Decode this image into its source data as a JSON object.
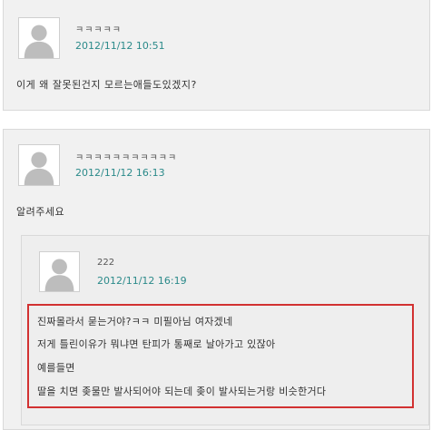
{
  "comments": [
    {
      "name": "ㅋㅋㅋㅋㅋ",
      "date": "2012/11/12 10:51",
      "body": "이게 왜 잘못된건지 모르는애들도있겠지?"
    },
    {
      "name": "ㅋㅋㅋㅋㅋㅋㅋㅋㅋㅋㅋ",
      "date": "2012/11/12 16:13",
      "body": "알려주세요",
      "reply": {
        "name": "222",
        "date": "2012/11/12 16:19",
        "lines": [
          "진짜몰라서 묻는거야?ㅋㅋ 미필아님 여자겠네",
          "저게 틀린이유가 뭐냐면 탄피가 통째로 날아가고 있잖아",
          "예를들면",
          "딸을 치면 좆물만 발사되어야 되는데 좆이 발사되는거랑 비슷한거다"
        ]
      }
    }
  ],
  "colors": {
    "date": "#2b8a8a",
    "highlight_border": "#d23131",
    "card_background": "#f1f1f1"
  },
  "icons": {
    "avatar": "default-user-avatar-icon"
  }
}
